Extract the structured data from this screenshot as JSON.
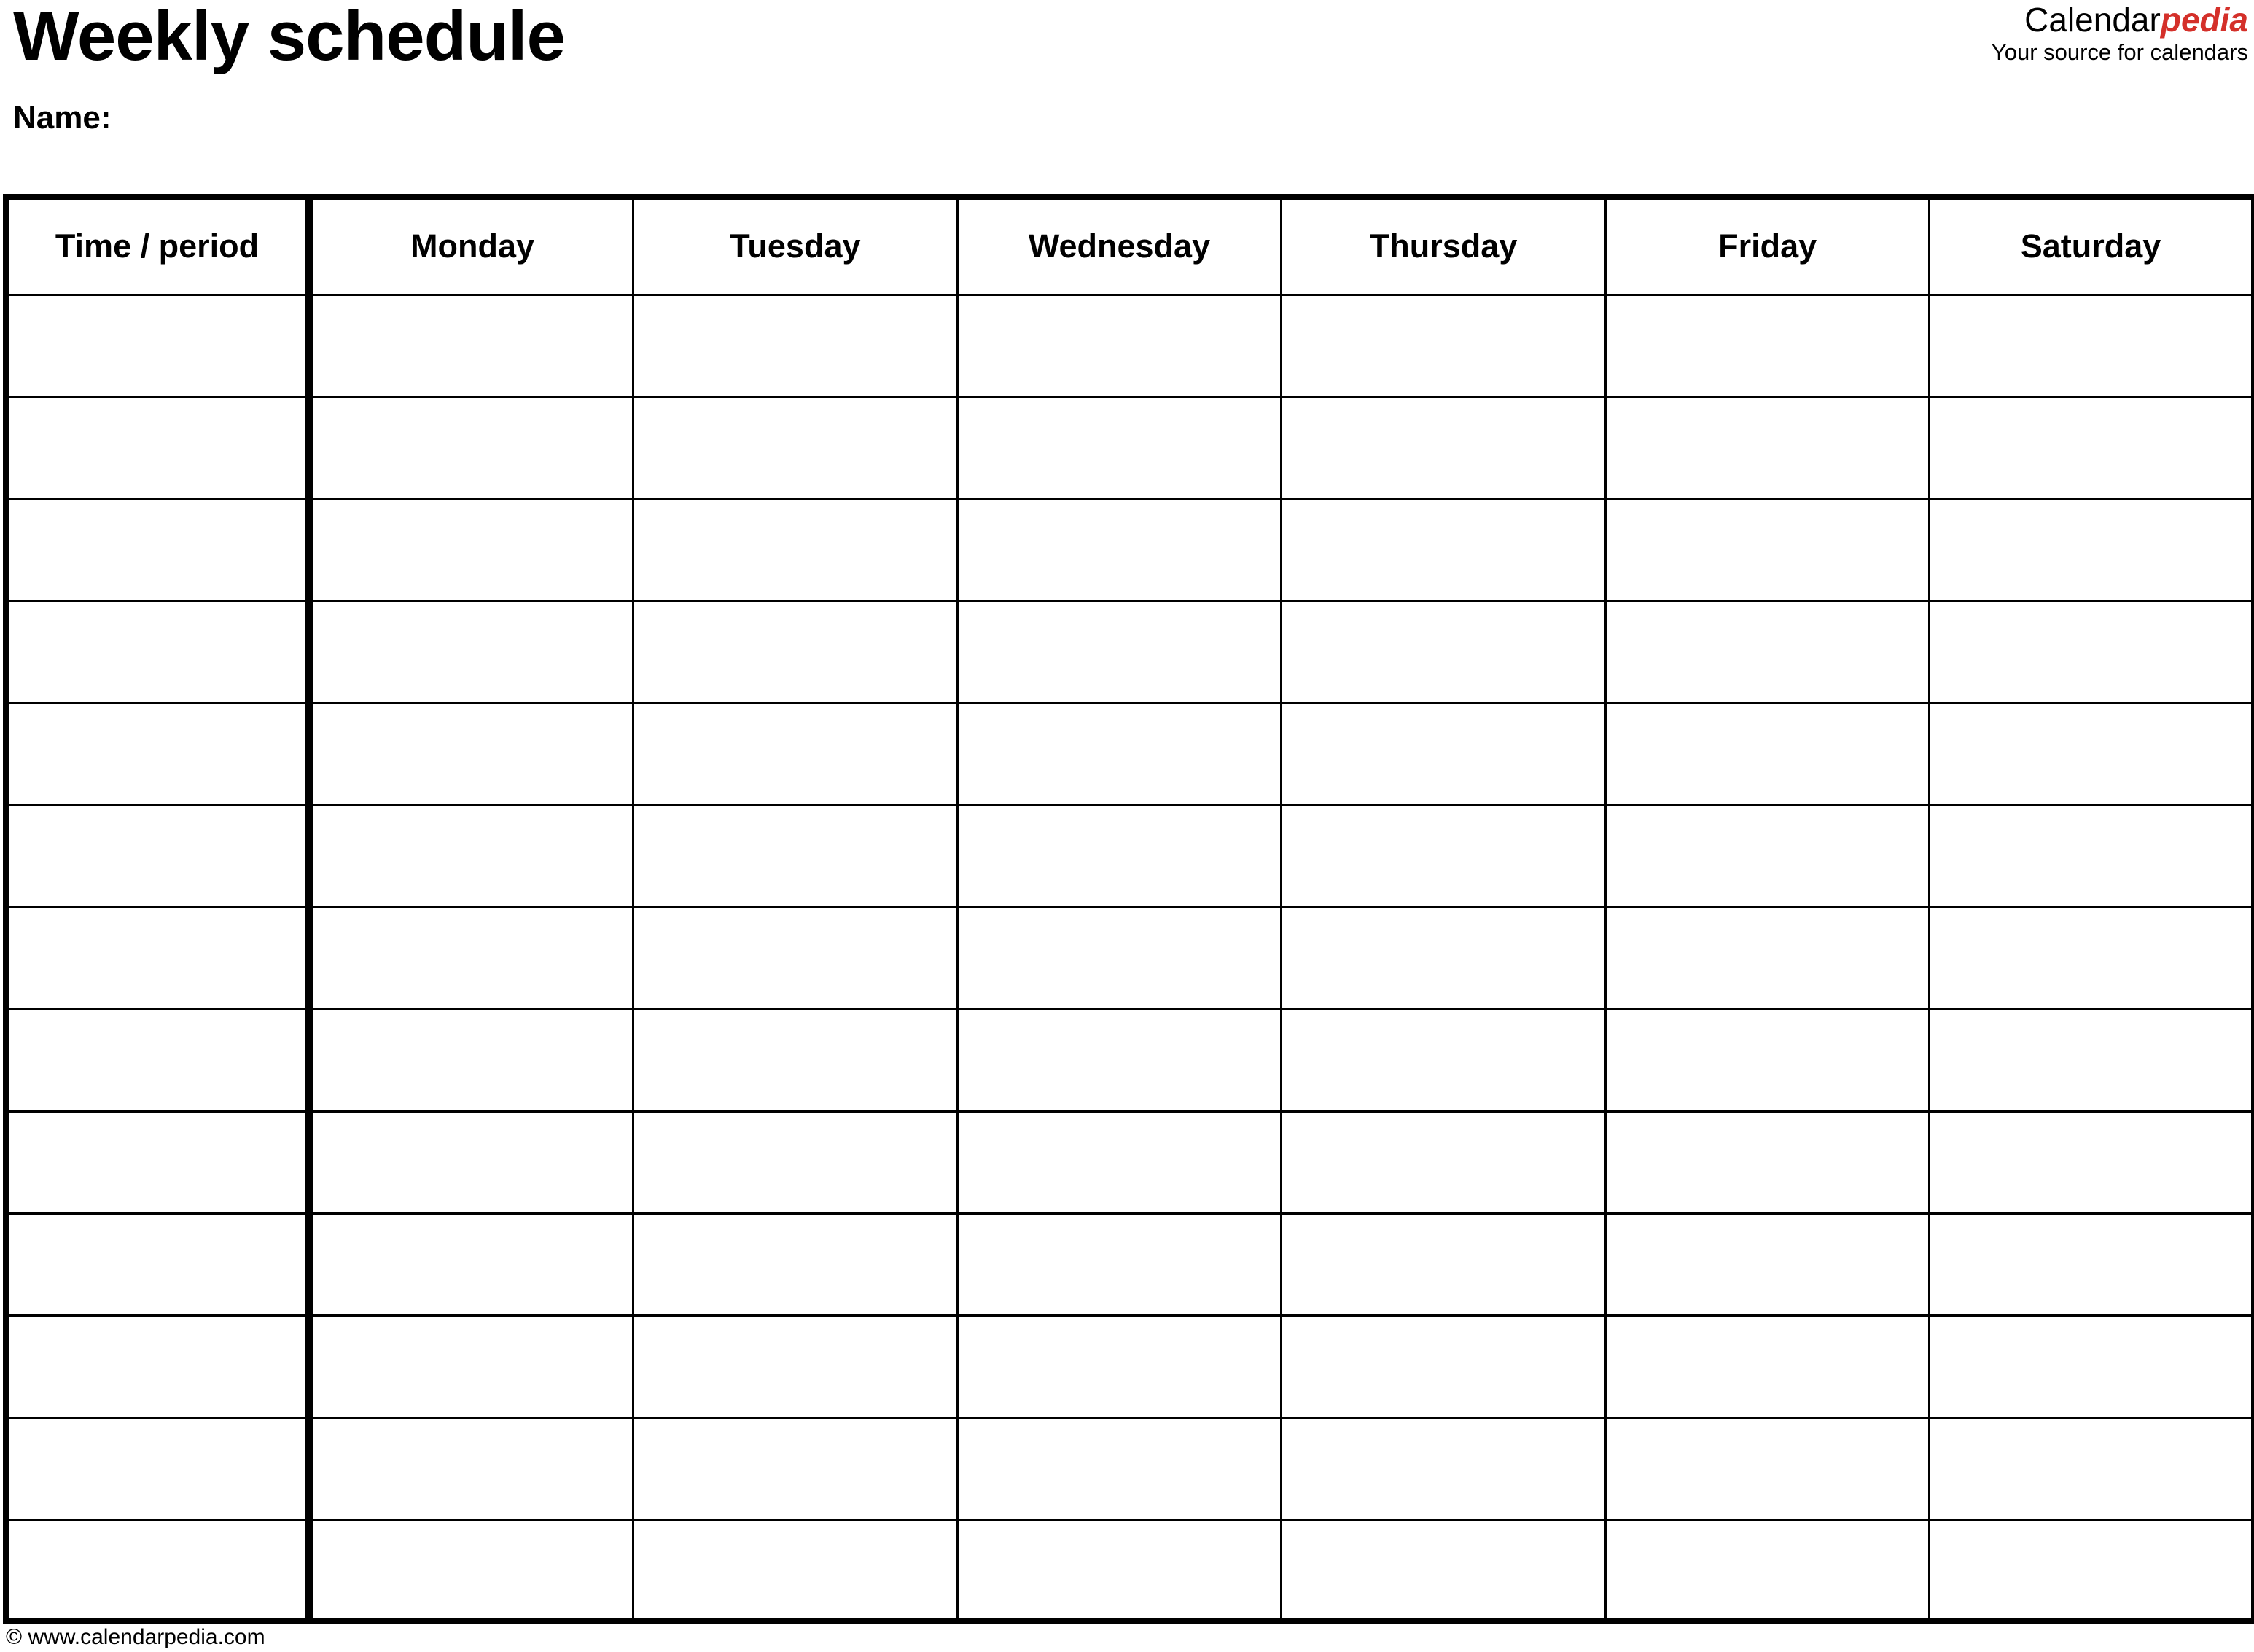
{
  "document": {
    "title": "Weekly schedule",
    "name_label": "Name:"
  },
  "brand": {
    "name_part_1": "Calendar",
    "name_part_2": "pedia",
    "tagline": "Your source for calendars",
    "accent_color": "#d4302a",
    "text_color": "#000000"
  },
  "table": {
    "columns": [
      {
        "key": "time",
        "label": "Time / period"
      },
      {
        "key": "monday",
        "label": "Monday"
      },
      {
        "key": "tuesday",
        "label": "Tuesday"
      },
      {
        "key": "wednesday",
        "label": "Wednesday"
      },
      {
        "key": "thursday",
        "label": "Thursday"
      },
      {
        "key": "friday",
        "label": "Friday"
      },
      {
        "key": "saturday",
        "label": "Saturday"
      }
    ],
    "row_count": 13,
    "rows": [
      {
        "time": "",
        "monday": "",
        "tuesday": "",
        "wednesday": "",
        "thursday": "",
        "friday": "",
        "saturday": ""
      },
      {
        "time": "",
        "monday": "",
        "tuesday": "",
        "wednesday": "",
        "thursday": "",
        "friday": "",
        "saturday": ""
      },
      {
        "time": "",
        "monday": "",
        "tuesday": "",
        "wednesday": "",
        "thursday": "",
        "friday": "",
        "saturday": ""
      },
      {
        "time": "",
        "monday": "",
        "tuesday": "",
        "wednesday": "",
        "thursday": "",
        "friday": "",
        "saturday": ""
      },
      {
        "time": "",
        "monday": "",
        "tuesday": "",
        "wednesday": "",
        "thursday": "",
        "friday": "",
        "saturday": ""
      },
      {
        "time": "",
        "monday": "",
        "tuesday": "",
        "wednesday": "",
        "thursday": "",
        "friday": "",
        "saturday": ""
      },
      {
        "time": "",
        "monday": "",
        "tuesday": "",
        "wednesday": "",
        "thursday": "",
        "friday": "",
        "saturday": ""
      },
      {
        "time": "",
        "monday": "",
        "tuesday": "",
        "wednesday": "",
        "thursday": "",
        "friday": "",
        "saturday": ""
      },
      {
        "time": "",
        "monday": "",
        "tuesday": "",
        "wednesday": "",
        "thursday": "",
        "friday": "",
        "saturday": ""
      },
      {
        "time": "",
        "monday": "",
        "tuesday": "",
        "wednesday": "",
        "thursday": "",
        "friday": "",
        "saturday": ""
      },
      {
        "time": "",
        "monday": "",
        "tuesday": "",
        "wednesday": "",
        "thursday": "",
        "friday": "",
        "saturday": ""
      },
      {
        "time": "",
        "monday": "",
        "tuesday": "",
        "wednesday": "",
        "thursday": "",
        "friday": "",
        "saturday": ""
      },
      {
        "time": "",
        "monday": "",
        "tuesday": "",
        "wednesday": "",
        "thursday": "",
        "friday": "",
        "saturday": ""
      }
    ]
  },
  "footer": {
    "copyright": "© www.calendarpedia.com"
  }
}
